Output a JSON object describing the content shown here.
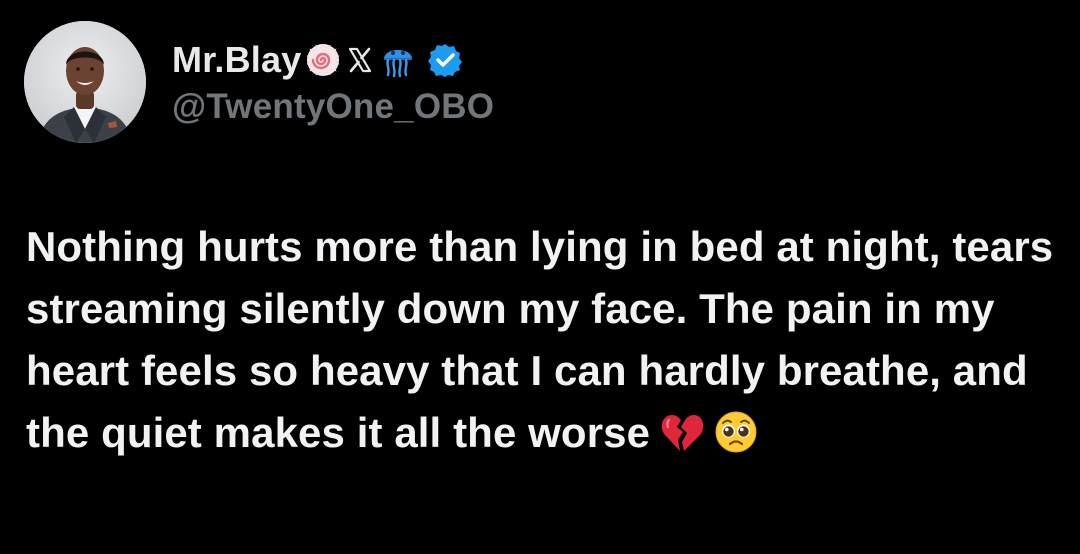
{
  "author": {
    "display_name": "Mr.Blay",
    "handle": "@TwentyOne_OBO",
    "badges": [
      "fishcake-icon",
      "x-logo-icon",
      "jellyfish-icon",
      "verified-badge-icon"
    ]
  },
  "post": {
    "text": "Nothing hurts more than lying in bed at night, tears streaming silently down my face. The pain in my heart feels so heavy that I can hardly breathe, and the quiet makes it all the worse",
    "emojis": [
      "broken-heart-icon",
      "pleading-face-icon"
    ]
  },
  "colors": {
    "background": "#000000",
    "text": "#e7e9ea",
    "handle": "#71767b",
    "verified": "#1d9bf0"
  }
}
